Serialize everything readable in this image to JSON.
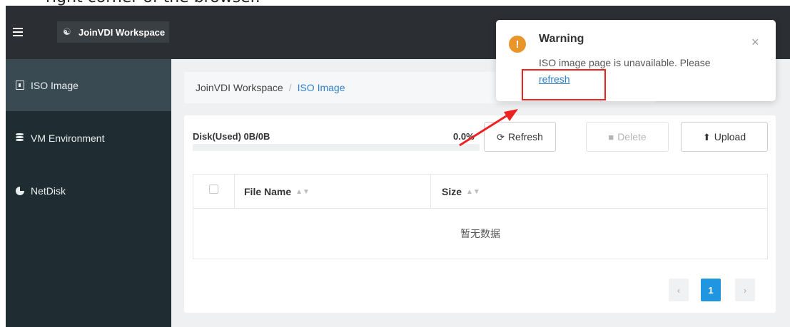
{
  "caption": {
    "text": "right corner of the browser."
  },
  "header": {
    "title": "JoinVDI Workspace",
    "brand_icon": "cluster-icon"
  },
  "sidebar": {
    "items": [
      {
        "label": "ISO Image",
        "icon": "file-icon",
        "active": true
      },
      {
        "label": "VM Environment",
        "icon": "database-icon",
        "active": false
      },
      {
        "label": "NetDisk",
        "icon": "pie-chart-icon",
        "active": false
      }
    ]
  },
  "breadcrumb": {
    "root": "JoinVDI Workspace",
    "separator": "/",
    "current": "ISO Image"
  },
  "disk": {
    "label": "Disk(Used) 0B/0B",
    "percent": "0.0%",
    "used_fraction": 0
  },
  "toolbar": {
    "refresh": "Refresh",
    "delete": "Delete",
    "upload": "Upload"
  },
  "table": {
    "columns": [
      "File Name",
      "Size"
    ],
    "empty_text": "暂无数据"
  },
  "pagination": {
    "prev": "‹",
    "current": "1",
    "next": "›"
  },
  "toast": {
    "title": "Warning",
    "message": "ISO image page is unavailable. Please",
    "link": "refresh",
    "close": "×",
    "accent": "#e8952a"
  },
  "colors": {
    "header": "#2b2f33",
    "sidebar": "#1f2c32",
    "sidebar_active": "#3a4a52",
    "link": "#2e7ec8",
    "annotation": "#ee2222"
  }
}
